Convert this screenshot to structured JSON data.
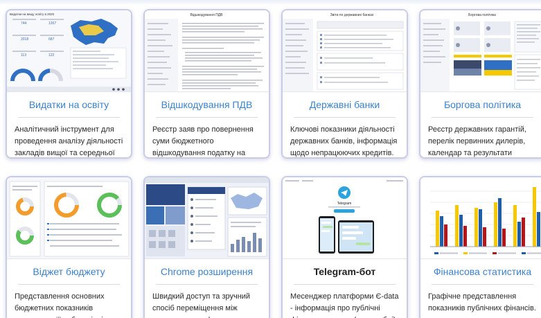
{
  "cards": [
    {
      "title": "Видатки на освіту",
      "description": "Аналітичний інструмент для проведення аналізу діяльності закладів вищої та середньої освіти.",
      "preview": {
        "heading": "Видатки на вищу освіту в 2020",
        "stats": [
          "744",
          "1267",
          "2018",
          "687",
          "113",
          "122"
        ]
      }
    },
    {
      "title": "Відшкодування ПДВ",
      "description": "Реєстр заяв про повернення суми бюджетного відшкодування податку на додану вартість.",
      "preview": {
        "heading": "Відшкодування ПДВ"
      }
    },
    {
      "title": "Державні банки",
      "description": "Ключові показники діяльності державних банків, інформація щодо непрацюючих кредитів.",
      "preview": {
        "heading": "Звіти по державних банках"
      }
    },
    {
      "title": "Боргова політика",
      "description": "Реєстр державних гарантій, перелік первинних дилерів, календар та результати аукціонів.",
      "preview": {
        "heading": "Боргова політика"
      }
    },
    {
      "title": "Віджет бюджету",
      "description": "Представлення основних бюджетних показників громади на її вебсторінці.",
      "preview": {}
    },
    {
      "title": "Chrome розширення",
      "description": "Швидкий доступ та зручний спосіб переміщення між модулями платформи.",
      "preview": {}
    },
    {
      "title": "Telegram-бот",
      "description": "Месенджер платформи Є-data - інформація про публічні фінанси держави (в розробці).",
      "preview": {
        "app_name": "Telegram"
      }
    },
    {
      "title": "Фінансова статистика",
      "description": "Графічне представлення показників публічних фінансів.",
      "preview": {}
    }
  ],
  "colors": {
    "title": "#3b82c9",
    "card_border": "#c9cce6",
    "chart_yellow": "#f5c800",
    "chart_blue": "#1f5faa",
    "chart_red": "#b3151b",
    "donut_orange": "#f39c2b",
    "donut_green": "#5bbf5a",
    "donut_blue": "#2f6fc4"
  }
}
